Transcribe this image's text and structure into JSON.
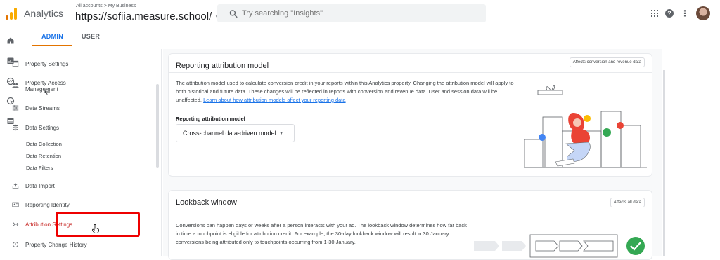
{
  "app": {
    "name": "Analytics",
    "breadcrumb": "All accounts > My Business",
    "property": "https://sofiia.measure.school/",
    "search_placeholder": "Try searching \"Insights\"",
    "accent": "#1a73e8",
    "highlight_color": "#ee0000"
  },
  "tabs": [
    {
      "label": "ADMIN",
      "active": true
    },
    {
      "label": "USER",
      "active": false
    }
  ],
  "nav": {
    "items": [
      {
        "label": "Property Settings",
        "icon": "property-icon"
      },
      {
        "label": "Property Access Management",
        "icon": "people-icon"
      },
      {
        "label": "Data Streams",
        "icon": "streams-icon"
      },
      {
        "label": "Data Settings",
        "icon": "database-icon"
      },
      {
        "label": "Data Import",
        "icon": "upload-icon"
      },
      {
        "label": "Reporting Identity",
        "icon": "identity-icon"
      },
      {
        "label": "Attribution Settings",
        "icon": "attribution-icon",
        "active": true
      },
      {
        "label": "Property Change History",
        "icon": "history-icon"
      }
    ],
    "data_settings_sub": [
      "Data Collection",
      "Data Retention",
      "Data Filters"
    ]
  },
  "attribution": {
    "title": "Reporting attribution model",
    "chip": "Affects conversion and revenue data",
    "description": "The attribution model used to calculate conversion credit in your reports within this Analytics property. Changing the attribution model will apply to both historical and future data. These changes will be reflected in reports with conversion and revenue data. User and session data will be unaffected.",
    "link": "Learn about how attribution models affect your reporting data",
    "field_label": "Reporting attribution model",
    "selected_model": "Cross-channel data-driven model"
  },
  "lookback": {
    "title": "Lookback window",
    "chip": "Affects all data",
    "description": "Conversions can happen days or weeks after a person interacts with your ad. The lookback window determines how far back in time a touchpoint is eligible for attribution credit. For example, the 30-day lookback window will result in 30 January conversions being attributed only to touchpoints occurring from 1-30 January."
  }
}
